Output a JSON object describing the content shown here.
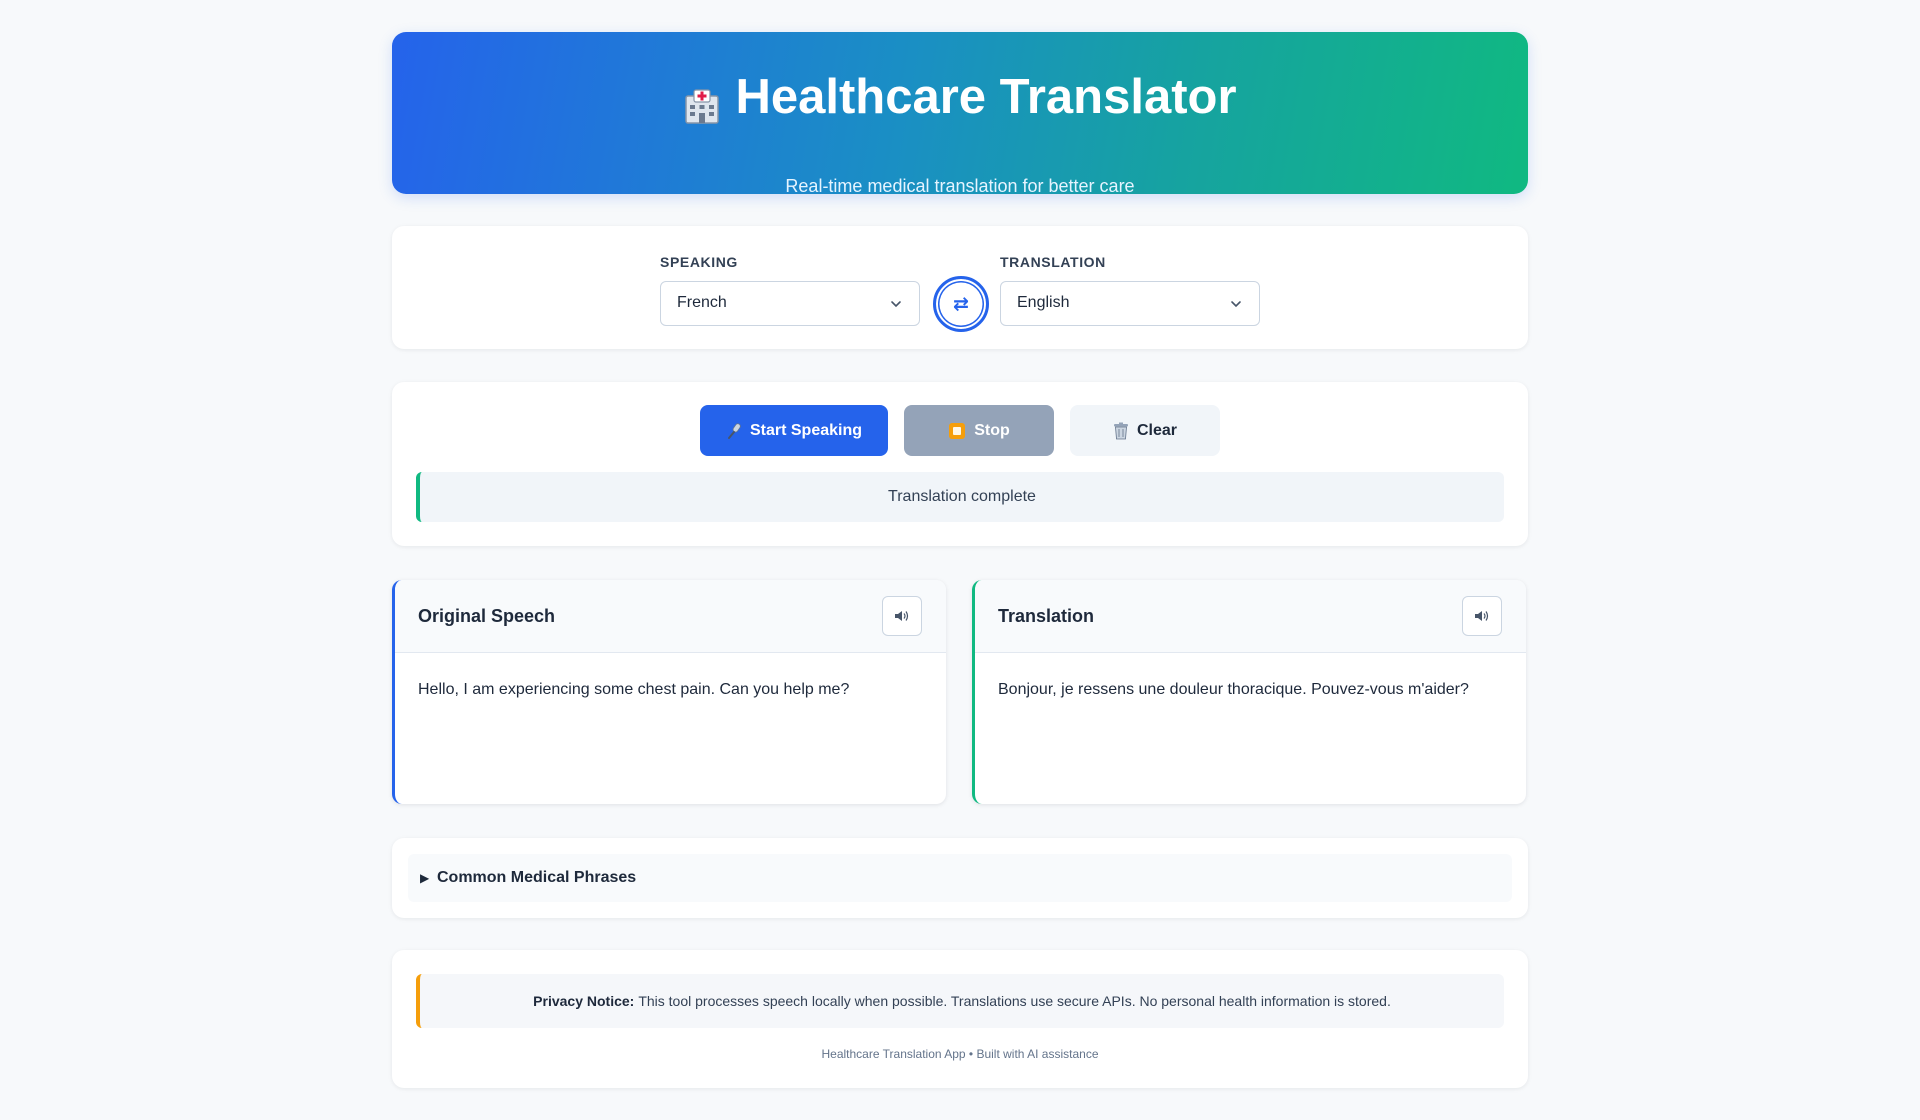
{
  "header": {
    "title": "Healthcare Translator",
    "subtitle": "Real-time medical translation for better care",
    "icon": "hospital-icon"
  },
  "languages": {
    "speaking_label": "SPEAKING",
    "speaking_value": "French",
    "translation_label": "TRANSLATION",
    "translation_value": "English",
    "swap_symbol": "⇄"
  },
  "controls": {
    "start_label": "Start Speaking",
    "stop_label": "Stop",
    "clear_label": "Clear",
    "status_text": "Translation complete"
  },
  "panels": {
    "original_title": "Original Speech",
    "original_text": "Hello, I am experiencing some chest pain. Can you help me?",
    "translation_title": "Translation",
    "translation_text": "Bonjour, je ressens une douleur thoracique. Pouvez-vous m'aider?"
  },
  "phrases": {
    "arrow": "▶",
    "label": "Common Medical Phrases"
  },
  "privacy": {
    "bold": "Privacy Notice:",
    "text": "This tool processes speech locally when possible. Translations use secure APIs. No personal health information is stored.",
    "footer": "Healthcare Translation App • Built with AI assistance"
  },
  "colors": {
    "primary": "#2563eb",
    "accent_green": "#10b981",
    "warning": "#f59e0b",
    "stop_gray": "#94a3b8"
  }
}
